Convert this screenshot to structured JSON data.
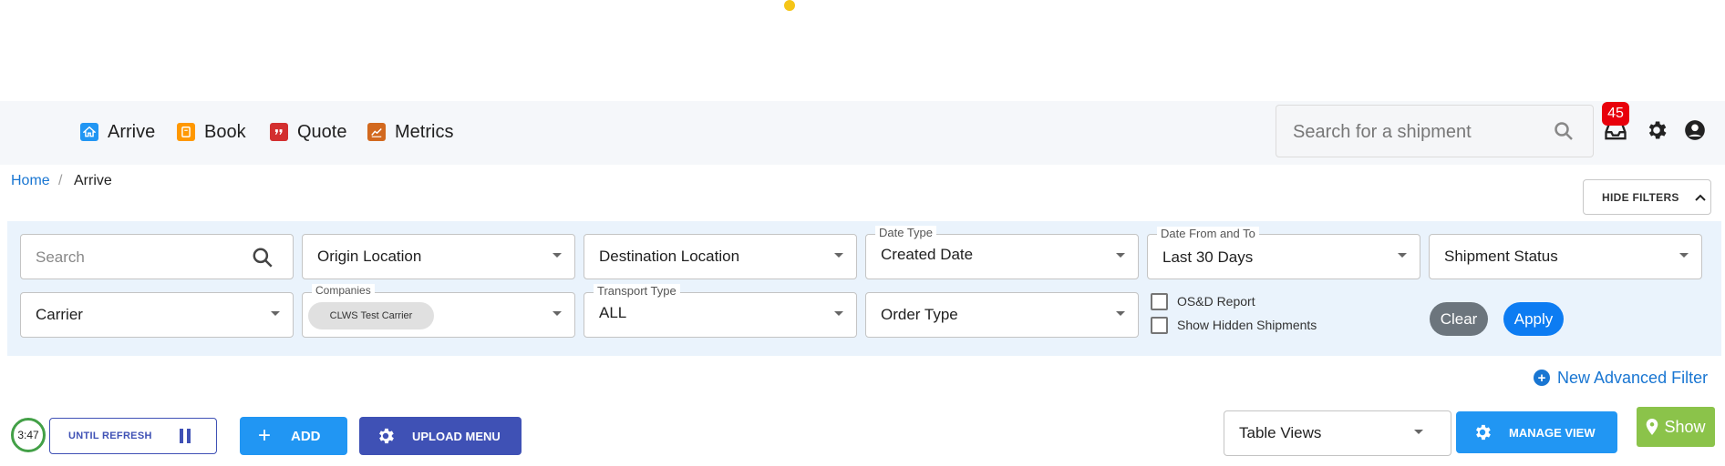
{
  "nav": {
    "items": [
      {
        "label": "Arrive",
        "icon": "home-icon",
        "color": "#2196f3"
      },
      {
        "label": "Book",
        "icon": "book-icon",
        "color": "#ff9800"
      },
      {
        "label": "Quote",
        "icon": "quote-icon",
        "color": "#d32f2f"
      },
      {
        "label": "Metrics",
        "icon": "chart-icon",
        "color": "#d2691e"
      }
    ],
    "search_placeholder": "Search for a shipment",
    "notification_count": "45"
  },
  "breadcrumb": {
    "home": "Home",
    "separator": "/",
    "current": "Arrive"
  },
  "filters": {
    "hide_label": "HIDE FILTERS",
    "search_placeholder": "Search",
    "origin": "Origin Location",
    "destination": "Destination Location",
    "date_type_label": "Date Type",
    "date_type_value": "Created Date",
    "date_range_label": "Date From and To",
    "date_range_value": "Last 30 Days",
    "shipment_status": "Shipment Status",
    "carrier": "Carrier",
    "companies_label": "Companies",
    "companies_chip": "CLWS Test Carrier",
    "transport_type_label": "Transport Type",
    "transport_type_value": "ALL",
    "order_type": "Order Type",
    "osd_report": "OS&D Report",
    "show_hidden": "Show Hidden Shipments",
    "clear": "Clear",
    "apply": "Apply",
    "new_advanced": "New Advanced Filter"
  },
  "toolbar": {
    "timer": "3:47",
    "until_refresh": "UNTIL REFRESH",
    "add": "ADD",
    "upload_menu": "UPLOAD MENU",
    "table_views": "Table Views",
    "manage_view": "MANAGE VIEW",
    "show": "Show"
  },
  "colors": {
    "accent_blue": "#2196f3",
    "indigo": "#3f51b5",
    "badge_red": "#e8000b",
    "green": "#8bc34a"
  }
}
